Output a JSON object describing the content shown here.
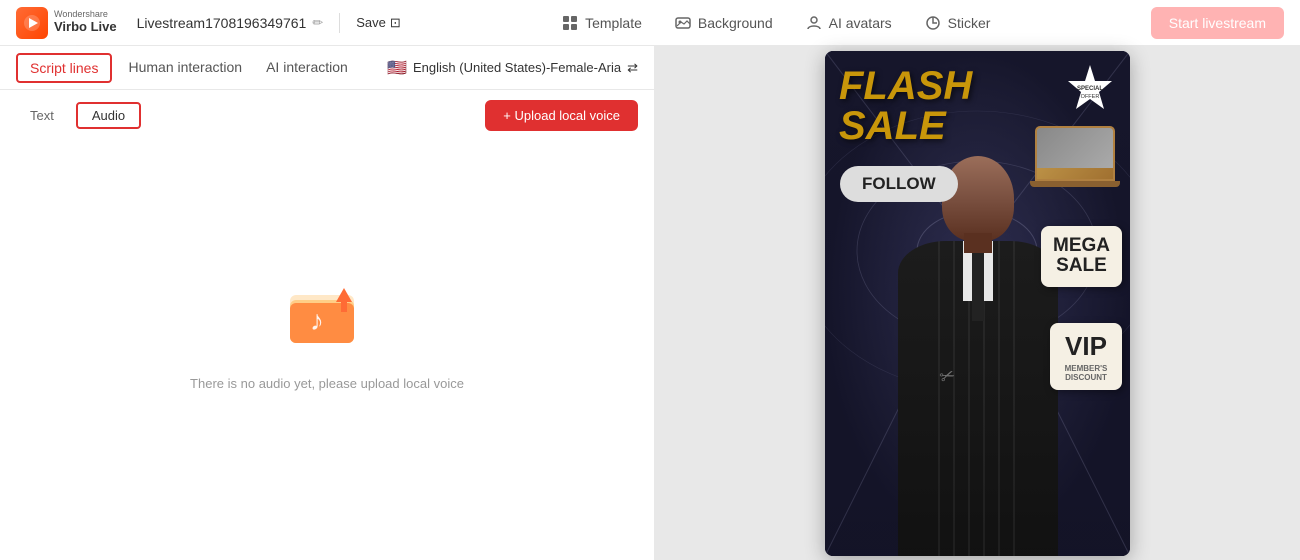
{
  "topbar": {
    "logo_top": "Wondershare",
    "logo_bottom": "Virbo Live",
    "project_name": "Livestream1708196349761",
    "edit_icon": "✏",
    "save_label": "Save",
    "save_icon": "⊡",
    "nav_items": [
      {
        "id": "template",
        "label": "Template",
        "icon": "▦"
      },
      {
        "id": "background",
        "label": "Background",
        "icon": "◫"
      },
      {
        "id": "ai-avatars",
        "label": "AI avatars",
        "icon": "👤"
      },
      {
        "id": "sticker",
        "label": "Sticker",
        "icon": "✦"
      }
    ],
    "start_button": "Start livestream"
  },
  "left_panel": {
    "tabs": [
      {
        "id": "script-lines",
        "label": "Script lines",
        "active": true,
        "outlined": true
      },
      {
        "id": "human-interaction",
        "label": "Human interaction",
        "active": false
      },
      {
        "id": "ai-interaction",
        "label": "AI interaction",
        "active": false
      }
    ],
    "language_selector": {
      "flag": "🇺🇸",
      "label": "English (United States)-Female-Aria",
      "icon": "⇄"
    },
    "sub_tabs": [
      {
        "id": "text",
        "label": "Text",
        "active": false
      },
      {
        "id": "audio",
        "label": "Audio",
        "active": true
      }
    ],
    "upload_button": "+ Upload local voice",
    "empty_state_text": "There is no audio yet, please upload local voice"
  },
  "preview": {
    "flash_sale_line1": "FLASH",
    "flash_sale_line2": "SALE",
    "follow_label": "FOLLOW",
    "mega_sale_line1": "MEGA",
    "mega_sale_line2": "SALE",
    "vip_label": "VIP",
    "member_label": "MEMBER'S",
    "discount_label": "DISCOUNT",
    "special_badge_text": "SPECIAL OFFER"
  }
}
